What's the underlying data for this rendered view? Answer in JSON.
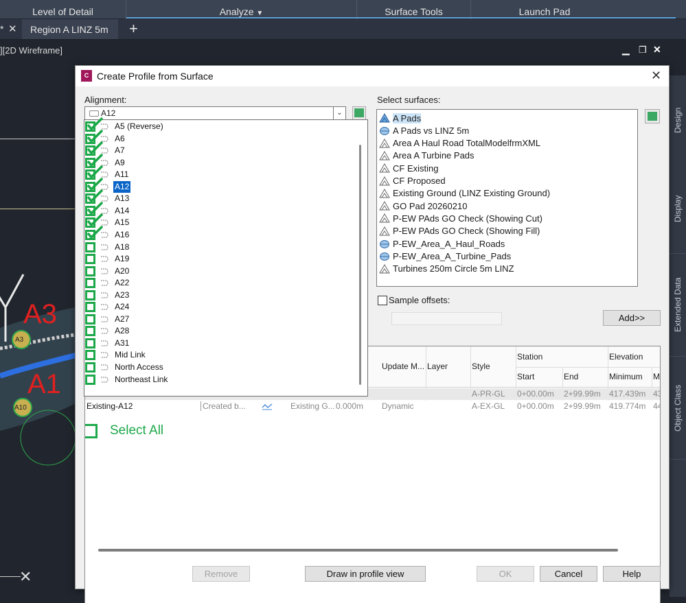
{
  "ribbon": {
    "tabs": [
      {
        "label": "Level of Detail"
      },
      {
        "label": "Analyze"
      },
      {
        "label": "Surface Tools"
      },
      {
        "label": "Launch Pad"
      }
    ]
  },
  "docbar": {
    "prev_marker": "*",
    "tab_label": "Region A LINZ 5m",
    "new_tab": "+"
  },
  "viewport": {
    "label": "][2D Wireframe]",
    "markers": [
      "A3",
      "A1",
      "A10",
      "A3"
    ]
  },
  "right_panel": {
    "tabs": [
      "Design",
      "Display",
      "Extended Data",
      "Object Class"
    ]
  },
  "dialog": {
    "title": "Create Profile from Surface",
    "alignment_label": "Alignment:",
    "alignment_value": "A12",
    "surfaces_label": "Select surfaces:",
    "surfaces": [
      {
        "name": "A Pads",
        "icon": "tin-surface-selected-icon",
        "selected": true
      },
      {
        "name": "A Pads vs LINZ 5m",
        "icon": "volume-surface-icon"
      },
      {
        "name": "Area A Haul Road TotalModelfrmXML",
        "icon": "tin-surface-icon"
      },
      {
        "name": "Area A Turbine Pads",
        "icon": "tin-surface-icon"
      },
      {
        "name": "CF Existing",
        "icon": "tin-surface-icon"
      },
      {
        "name": "CF Proposed",
        "icon": "tin-surface-icon"
      },
      {
        "name": "Existing Ground (LINZ Existing Ground)",
        "icon": "tin-surface-icon"
      },
      {
        "name": "GO Pad 20260210",
        "icon": "tin-surface-icon"
      },
      {
        "name": "P-EW PAds GO Check (Showing Cut)",
        "icon": "tin-surface-icon"
      },
      {
        "name": "P-EW PAds GO Check (Showing Fill)",
        "icon": "tin-surface-icon"
      },
      {
        "name": "P-EW_Area_A_Haul_Roads",
        "icon": "volume-surface-icon"
      },
      {
        "name": "P-EW_Area_A_Turbine_Pads",
        "icon": "volume-surface-icon"
      },
      {
        "name": "Turbines 250m Circle 5m LINZ",
        "icon": "tin-surface-icon"
      }
    ],
    "sample_offsets_label": "Sample offsets:",
    "add_button": "Add>>",
    "grid": {
      "headers": {
        "update_mode": "Update M...",
        "layer": "Layer",
        "style": "Style",
        "station": "Station",
        "start": "Start",
        "end": "End",
        "elevation": "Elevation",
        "minimum": "Minimum",
        "max": "M."
      },
      "rows": [
        {
          "name": "",
          "description": "",
          "source": "",
          "offset": "",
          "update": "",
          "layer": "",
          "style": "A-PR-GL",
          "start": "0+00.00m",
          "end": "2+99.99m",
          "min": "417.439m",
          "max": "43"
        },
        {
          "name": "Existing-A12",
          "description": "Created b...",
          "source": "Existing G...",
          "offset": "0.000m",
          "update": "Dynamic",
          "layer": "",
          "style": "A-EX-GL",
          "start": "0+00.00m",
          "end": "2+99.99m",
          "min": "419.774m",
          "max": "44"
        }
      ]
    },
    "select_all_label": "Select All",
    "buttons": {
      "remove": "Remove",
      "draw": "Draw in profile view",
      "ok": "OK",
      "cancel": "Cancel",
      "help": "Help"
    },
    "dropdown_items": [
      {
        "label": "A5 (Reverse)",
        "checked": true
      },
      {
        "label": "A6",
        "checked": true
      },
      {
        "label": "A7",
        "checked": true
      },
      {
        "label": "A9",
        "checked": true
      },
      {
        "label": "A11",
        "checked": true
      },
      {
        "label": "A12",
        "checked": true,
        "selected": true
      },
      {
        "label": "A13",
        "checked": true
      },
      {
        "label": "A14",
        "checked": true
      },
      {
        "label": "A15",
        "checked": true
      },
      {
        "label": "A16",
        "checked": true
      },
      {
        "label": "A18",
        "checked": false
      },
      {
        "label": "A19",
        "checked": false
      },
      {
        "label": "A20",
        "checked": false
      },
      {
        "label": "A22",
        "checked": false
      },
      {
        "label": "A23",
        "checked": false
      },
      {
        "label": "A24",
        "checked": false
      },
      {
        "label": "A27",
        "checked": false
      },
      {
        "label": "A28",
        "checked": false
      },
      {
        "label": "A31",
        "checked": false
      },
      {
        "label": "Mid Link",
        "checked": false
      },
      {
        "label": "North Access",
        "checked": false
      },
      {
        "label": "Northeast Link",
        "checked": false
      }
    ]
  },
  "colors": {
    "accent": "#1da84a",
    "selection": "#0a64c8",
    "dialog_bg": "#f0f0f0",
    "ribbon": "#3b4453",
    "viewport_red": "#e02020"
  }
}
